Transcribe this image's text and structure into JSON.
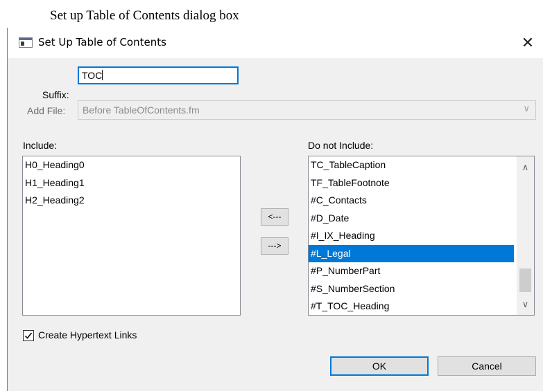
{
  "caption": "Set up Table of Contents dialog box",
  "dialog": {
    "title": "Set Up Table of Contents",
    "close_glyph": "✕",
    "suffix": {
      "label": "Suffix:",
      "value": "TOC"
    },
    "add_file": {
      "label": "Add File:",
      "value": "Before TableOfContents.fm"
    },
    "include": {
      "label": "Include:",
      "items": [
        "H0_Heading0",
        "H1_Heading1",
        "H2_Heading2"
      ]
    },
    "do_not_include": {
      "label": "Do not Include:",
      "items": [
        "TC_TableCaption",
        "TF_TableFootnote",
        "#C_Contacts",
        "#D_Date",
        "#I_IX_Heading",
        "#L_Legal",
        "#P_NumberPart",
        "#S_NumberSection",
        "#T_TOC_Heading"
      ],
      "selected": "#L_Legal"
    },
    "move_left_label": "<---",
    "move_right_label": "--->",
    "hypertext_checkbox": {
      "label": "Create Hypertext Links",
      "checked": true
    },
    "ok_label": "OK",
    "cancel_label": "Cancel"
  },
  "icons": {
    "app": "app-window-icon",
    "close": "close-icon",
    "dropdown": "chevron-down-icon",
    "scroll_up": "chevron-up-icon",
    "scroll_down": "chevron-down-icon",
    "check": "checkmark-icon"
  },
  "colors": {
    "accent": "#0078d7",
    "dialog_bg": "#f0f0f0",
    "selection_bg": "#0078d7"
  }
}
